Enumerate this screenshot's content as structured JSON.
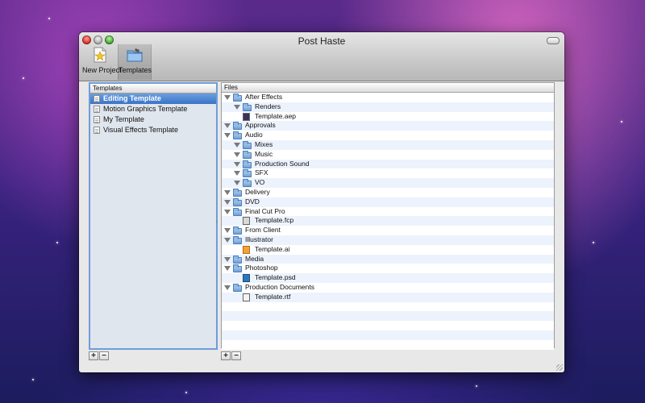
{
  "window": {
    "title": "Post Haste"
  },
  "toolbar": {
    "new_project_label": "New Project",
    "templates_label": "Templates"
  },
  "templates_panel": {
    "header": "Templates",
    "items": [
      {
        "label": "Editing Template",
        "selected": true
      },
      {
        "label": "Motion Graphics Template",
        "selected": false
      },
      {
        "label": "My Template",
        "selected": false
      },
      {
        "label": "Visual Effects Template",
        "selected": false
      }
    ],
    "add_label": "+",
    "remove_label": "−"
  },
  "files_panel": {
    "header": "Files",
    "rows": [
      {
        "label": "After Effects",
        "kind": "folder",
        "depth": 0,
        "expanded": true
      },
      {
        "label": "Renders",
        "kind": "folder",
        "depth": 1,
        "expanded": true
      },
      {
        "label": "Template.aep",
        "kind": "file",
        "icon": "after-effects-file-icon",
        "depth": 1
      },
      {
        "label": "Approvals",
        "kind": "folder",
        "depth": 0,
        "expanded": true
      },
      {
        "label": "Audio",
        "kind": "folder",
        "depth": 0,
        "expanded": true
      },
      {
        "label": "Mixes",
        "kind": "folder",
        "depth": 1,
        "expanded": true
      },
      {
        "label": "Music",
        "kind": "folder",
        "depth": 1,
        "expanded": true
      },
      {
        "label": "Production Sound",
        "kind": "folder",
        "depth": 1,
        "expanded": true
      },
      {
        "label": "SFX",
        "kind": "folder",
        "depth": 1,
        "expanded": true
      },
      {
        "label": "VO",
        "kind": "folder",
        "depth": 1,
        "expanded": true
      },
      {
        "label": "Delivery",
        "kind": "folder",
        "depth": 0,
        "expanded": true
      },
      {
        "label": "DVD",
        "kind": "folder",
        "depth": 0,
        "expanded": true
      },
      {
        "label": "Final Cut Pro",
        "kind": "folder",
        "depth": 0,
        "expanded": true
      },
      {
        "label": "Template.fcp",
        "kind": "file",
        "icon": "final-cut-file-icon",
        "depth": 1
      },
      {
        "label": "From Client",
        "kind": "folder",
        "depth": 0,
        "expanded": true
      },
      {
        "label": "Illustrator",
        "kind": "folder",
        "depth": 0,
        "expanded": true
      },
      {
        "label": "Template.ai",
        "kind": "file",
        "icon": "illustrator-file-icon",
        "depth": 1
      },
      {
        "label": "Media",
        "kind": "folder",
        "depth": 0,
        "expanded": true
      },
      {
        "label": "Photoshop",
        "kind": "folder",
        "depth": 0,
        "expanded": true
      },
      {
        "label": "Template.psd",
        "kind": "file",
        "icon": "photoshop-file-icon",
        "depth": 1
      },
      {
        "label": "Production Documents",
        "kind": "folder",
        "depth": 0,
        "expanded": true
      },
      {
        "label": "Template.rtf",
        "kind": "file",
        "icon": "rtf-file-icon",
        "depth": 1
      }
    ],
    "add_label": "+",
    "remove_label": "−"
  },
  "colors": {
    "selection": "#3a73c6",
    "folder": "#6f9fd6",
    "stripe": "#edf3fd"
  }
}
